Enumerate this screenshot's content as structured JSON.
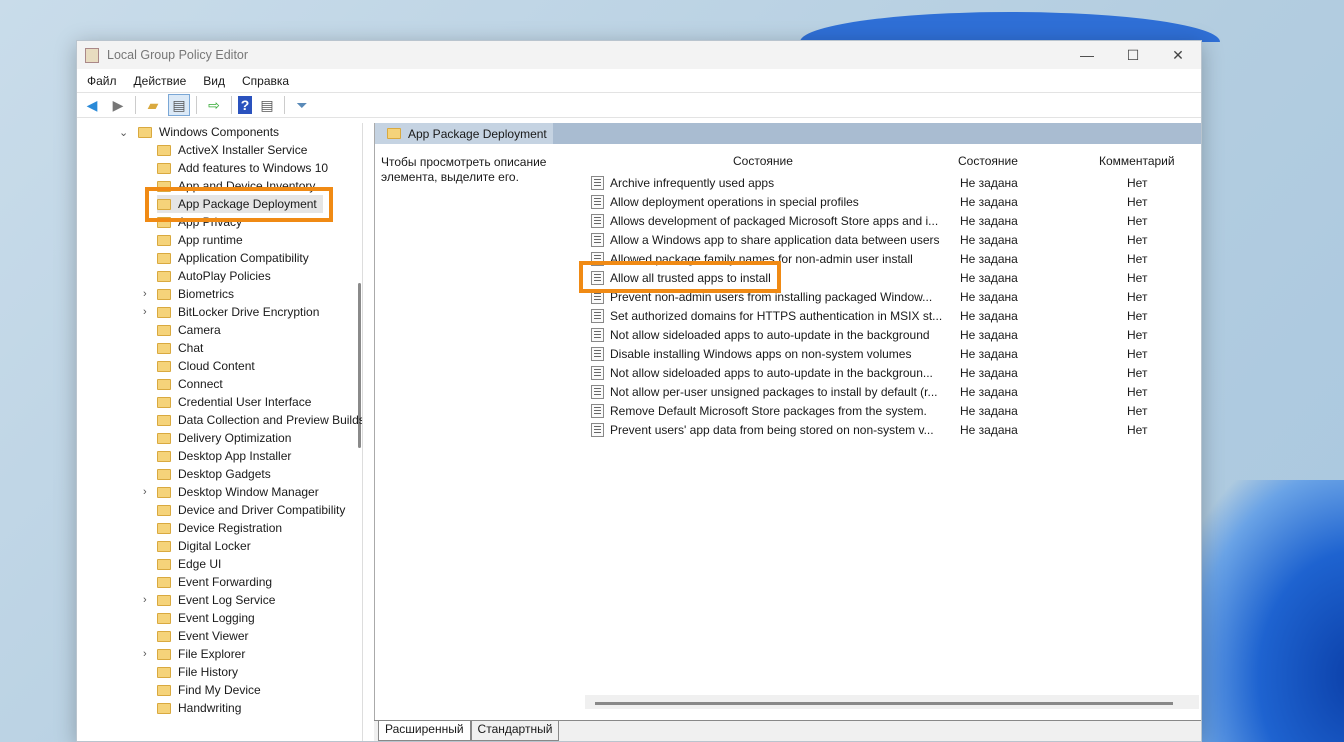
{
  "window": {
    "title": "Local Group Policy Editor",
    "minimize": "—",
    "maximize": "☐",
    "close": "✕"
  },
  "menu": [
    "Файл",
    "Действие",
    "Вид",
    "Справка"
  ],
  "toolbar": [
    "back-icon",
    "forward-icon",
    "up-folder-icon",
    "show-hide-tree-icon",
    "export-list-icon",
    "help-icon",
    "properties-pane-icon",
    "filter-icon"
  ],
  "tree": {
    "parent": "Windows Components",
    "items": [
      {
        "label": "ActiveX Installer Service",
        "exp": false
      },
      {
        "label": "Add features to Windows 10",
        "exp": false
      },
      {
        "label": "App and Device Inventory",
        "exp": false
      },
      {
        "label": "App Package Deployment",
        "exp": false,
        "selected": true
      },
      {
        "label": "App Privacy",
        "exp": false
      },
      {
        "label": "App runtime",
        "exp": false
      },
      {
        "label": "Application Compatibility",
        "exp": false
      },
      {
        "label": "AutoPlay Policies",
        "exp": false
      },
      {
        "label": "Biometrics",
        "exp": true
      },
      {
        "label": "BitLocker Drive Encryption",
        "exp": true
      },
      {
        "label": "Camera",
        "exp": false
      },
      {
        "label": "Chat",
        "exp": false
      },
      {
        "label": "Cloud Content",
        "exp": false
      },
      {
        "label": "Connect",
        "exp": false
      },
      {
        "label": "Credential User Interface",
        "exp": false
      },
      {
        "label": "Data Collection and Preview Builds",
        "exp": false
      },
      {
        "label": "Delivery Optimization",
        "exp": false
      },
      {
        "label": "Desktop App Installer",
        "exp": false
      },
      {
        "label": "Desktop Gadgets",
        "exp": false
      },
      {
        "label": "Desktop Window Manager",
        "exp": true
      },
      {
        "label": "Device and Driver Compatibility",
        "exp": false
      },
      {
        "label": "Device Registration",
        "exp": false
      },
      {
        "label": "Digital Locker",
        "exp": false
      },
      {
        "label": "Edge UI",
        "exp": false
      },
      {
        "label": "Event Forwarding",
        "exp": false
      },
      {
        "label": "Event Log Service",
        "exp": true
      },
      {
        "label": "Event Logging",
        "exp": false
      },
      {
        "label": "Event Viewer",
        "exp": false
      },
      {
        "label": "File Explorer",
        "exp": true
      },
      {
        "label": "File History",
        "exp": false
      },
      {
        "label": "Find My Device",
        "exp": false
      },
      {
        "label": "Handwriting",
        "exp": false
      }
    ]
  },
  "pane": {
    "header": "App Package Deployment",
    "description": "Чтобы просмотреть описание элемента, выделите его.",
    "columns": [
      "Состояние",
      "Состояние",
      "Комментарий"
    ],
    "rows": [
      {
        "name": "Archive infrequently used apps",
        "state": "Не задана",
        "comment": "Нет"
      },
      {
        "name": "Allow deployment operations in special profiles",
        "state": "Не задана",
        "comment": "Нет"
      },
      {
        "name": "Allows development of packaged Microsoft Store apps and i...",
        "state": "Не задана",
        "comment": "Нет"
      },
      {
        "name": "Allow a Windows app to share application data between users",
        "state": "Не задана",
        "comment": "Нет"
      },
      {
        "name": "Allowed package family names for non-admin user install",
        "state": "Не задана",
        "comment": "Нет"
      },
      {
        "name": "Allow all trusted apps to install",
        "state": "Не задана",
        "comment": "Нет"
      },
      {
        "name": "Prevent non-admin users from installing packaged Window...",
        "state": "Не задана",
        "comment": "Нет"
      },
      {
        "name": "Set authorized domains for HTTPS authentication in MSIX st...",
        "state": "Не задана",
        "comment": "Нет"
      },
      {
        "name": "Not allow sideloaded apps to auto-update in the background",
        "state": "Не задана",
        "comment": "Нет"
      },
      {
        "name": "Disable installing Windows apps on non-system volumes",
        "state": "Не задана",
        "comment": "Нет"
      },
      {
        "name": "Not allow sideloaded apps to auto-update in the backgroun...",
        "state": "Не задана",
        "comment": "Нет"
      },
      {
        "name": "Not allow per-user unsigned packages to install by default (r...",
        "state": "Не задана",
        "comment": "Нет"
      },
      {
        "name": "Remove Default Microsoft Store packages from the system.",
        "state": "Не задана",
        "comment": "Нет"
      },
      {
        "name": "Prevent users' app data from being stored on non-system v...",
        "state": "Не задана",
        "comment": "Нет"
      }
    ]
  },
  "tabs": [
    "Расширенный",
    "Стандартный"
  ],
  "colors": {
    "highlight": "#f08a14"
  }
}
